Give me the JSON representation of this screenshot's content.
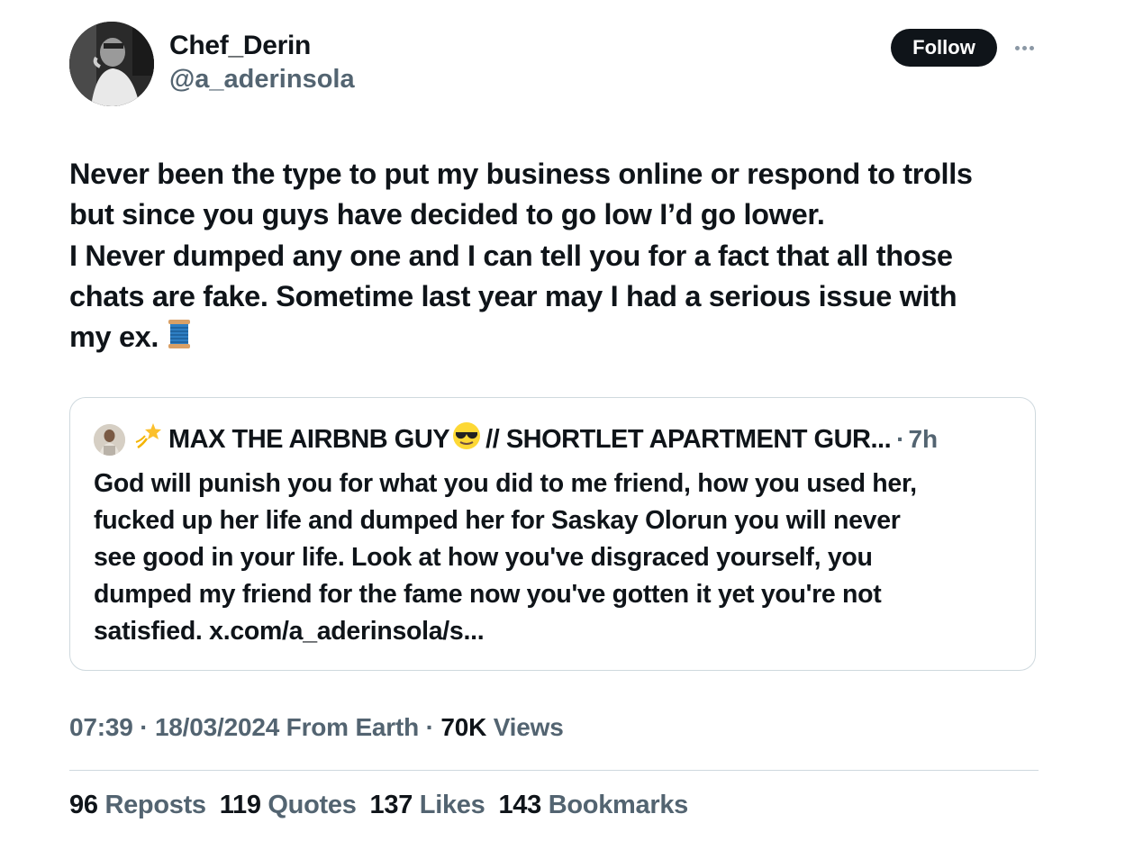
{
  "author": {
    "display_name": "Chef_Derin",
    "handle": "@a_aderinsola"
  },
  "follow_label": "Follow",
  "tweet_lines": [
    "Never been the type to put my business online or respond to trolls",
    "but since you guys have decided to go low I’d go lower.",
    "I Never dumped any one and I can tell you for a fact that all those",
    "chats are fake. Sometime last year may I had a serious issue with",
    "my ex."
  ],
  "tweet_emoji": "spool-of-thread-icon",
  "quote": {
    "name": "MAX THE AIRBNB GUY",
    "name_suffix": "// SHORTLET APARTMENT GUR...",
    "separator": "·",
    "time": "7h",
    "lines": [
      "God will punish you for what you did to me friend, how you used her,",
      "fucked up her life and dumped her for Saskay Olorun you will never",
      "see good in your life. Look at how you've disgraced yourself, you",
      "dumped my friend for the fame now you've gotten it yet you're not",
      "satisfied. x.com/a_aderinsola/s..."
    ]
  },
  "meta": {
    "time": "07:39",
    "sep1": "·",
    "date": "18/03/2024",
    "source": "From Earth",
    "sep2": "·",
    "views_count": "70K",
    "views_label": "Views"
  },
  "stats": [
    {
      "count": "96",
      "label": "Reposts"
    },
    {
      "count": "119",
      "label": "Quotes"
    },
    {
      "count": "137",
      "label": "Likes"
    },
    {
      "count": "143",
      "label": "Bookmarks"
    }
  ],
  "colors": {
    "text_primary": "#0f1419",
    "text_secondary": "#536471",
    "border": "#cfd9de",
    "button_bg": "#0f1419"
  }
}
